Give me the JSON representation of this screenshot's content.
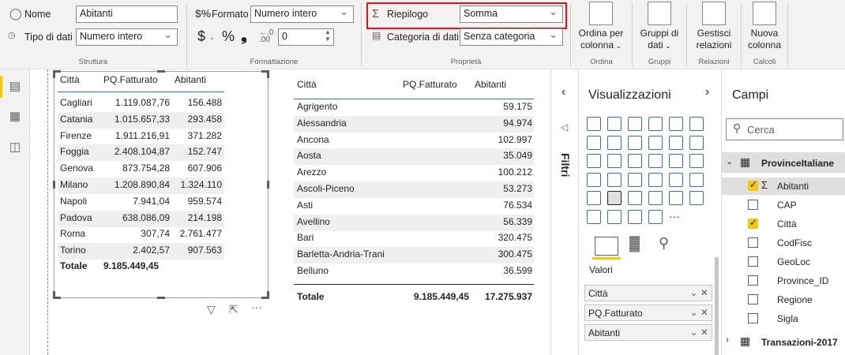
{
  "ribbon": {
    "struttura": {
      "nome_label": "Nome",
      "nome_value": "Abitanti",
      "tipo_label": "Tipo di dati",
      "tipo_value": "Numero intero",
      "group_label": "Struttura"
    },
    "formattazione": {
      "formato_label": "Formato",
      "formato_value": "Numero intero",
      "currency_symbol": "$",
      "percent_symbol": "%",
      "comma_symbol": "❟",
      "decimals_value": "0",
      "group_label": "Formattazione"
    },
    "proprieta": {
      "riepilogo_label": "Riepilogo",
      "riepilogo_value": "Somma",
      "categoria_label": "Categoria di dati",
      "categoria_value": "Senza categoria",
      "group_label": "Proprietà",
      "highlight_color": "#e81123"
    },
    "ordina": {
      "button_line1": "Ordina per",
      "button_line2": "colonna",
      "group_label": "Ordina"
    },
    "gruppi": {
      "button_line1": "Gruppi di",
      "button_line2": "dati",
      "group_label": "Gruppi"
    },
    "relazioni": {
      "button_line1": "Gestisci",
      "button_line2": "relazioni",
      "group_label": "Relazioni"
    },
    "calcoli": {
      "button_line1": "Nuova",
      "button_line2": "colonna",
      "group_label": "Calcoli"
    }
  },
  "rail": {
    "icons": [
      "report-view-icon",
      "data-view-icon",
      "model-view-icon"
    ],
    "accent": "#f2c811"
  },
  "table1": {
    "headers": [
      "Città",
      "PQ.Fatturato",
      "Abitanti"
    ],
    "rows": [
      [
        "Cagliari",
        "1.119.087,76",
        "156.488"
      ],
      [
        "Catania",
        "1.015.657,33",
        "293.458"
      ],
      [
        "Firenze",
        "1.911.216,91",
        "371.282"
      ],
      [
        "Foggia",
        "2.408.104,87",
        "152.747"
      ],
      [
        "Genova",
        "873.754,28",
        "607.906"
      ],
      [
        "Milano",
        "1.208.890,84",
        "1.324.110"
      ],
      [
        "Napoli",
        "7.941,04",
        "959.574"
      ],
      [
        "Padova",
        "638.086,09",
        "214.198"
      ],
      [
        "Roma",
        "307,74",
        "2.761.477"
      ],
      [
        "Torino",
        "2.402,57",
        "907.563"
      ]
    ],
    "total": [
      "Totale",
      "9.185.449,45",
      ""
    ]
  },
  "table2": {
    "headers": [
      "Città",
      "PQ.Fatturato",
      "Abitanti"
    ],
    "rows": [
      [
        "Agrigento",
        "",
        "59.175"
      ],
      [
        "Alessandria",
        "",
        "94.974"
      ],
      [
        "Ancona",
        "",
        "102.997"
      ],
      [
        "Aosta",
        "",
        "35.049"
      ],
      [
        "Arezzo",
        "",
        "100.212"
      ],
      [
        "Ascoli-Piceno",
        "",
        "53.273"
      ],
      [
        "Asti",
        "",
        "76.534"
      ],
      [
        "Avellino",
        "",
        "56.339"
      ],
      [
        "Bari",
        "",
        "320.475"
      ],
      [
        "Barletta-Andria-Trani",
        "",
        "300.475"
      ],
      [
        "Belluno",
        "",
        "36.599"
      ]
    ],
    "total": [
      "Totale",
      "9.185.449,45",
      "17.275.937"
    ]
  },
  "filters": {
    "label": "Filtri"
  },
  "visualizations": {
    "title": "Visualizzazioni",
    "section_label": "Valori",
    "wells": [
      "Città",
      "PQ.Fatturato",
      "Abitanti"
    ]
  },
  "fields": {
    "title": "Campi",
    "search_placeholder": "Cerca",
    "table1_name": "ProvinceItaliane",
    "items": [
      {
        "name": "Abitanti",
        "checked": true,
        "sigma": true
      },
      {
        "name": "CAP",
        "checked": false,
        "sigma": false
      },
      {
        "name": "Città",
        "checked": true,
        "sigma": false
      },
      {
        "name": "CodFisc",
        "checked": false,
        "sigma": false
      },
      {
        "name": "GeoLoc",
        "checked": false,
        "sigma": false
      },
      {
        "name": "Province_ID",
        "checked": false,
        "sigma": false
      },
      {
        "name": "Regione",
        "checked": false,
        "sigma": false
      },
      {
        "name": "Sigla",
        "checked": false,
        "sigma": false
      }
    ],
    "table2_name": "Transazioni-2017"
  }
}
